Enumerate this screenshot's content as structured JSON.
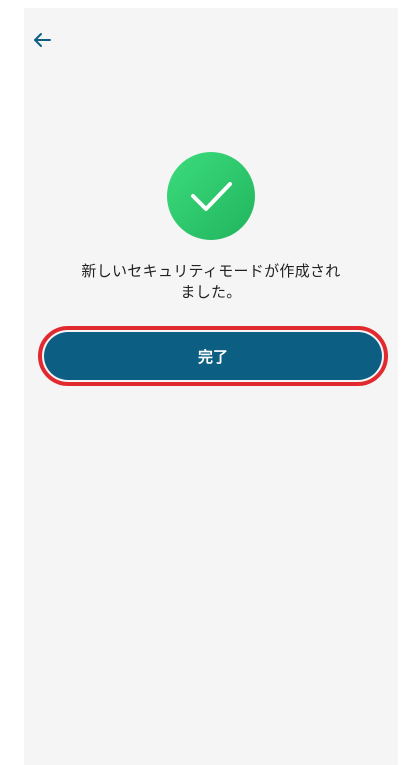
{
  "header": {
    "back_icon": "arrow-left-icon"
  },
  "success": {
    "icon": "check-circle-icon",
    "icon_color": "#2ccb6b",
    "message_line1": "新しいセキュリティモードが作成され",
    "message_line2": "ました。"
  },
  "actions": {
    "done_label": "完了",
    "button_color": "#0c5f82",
    "highlight_color": "#e02a2f"
  }
}
